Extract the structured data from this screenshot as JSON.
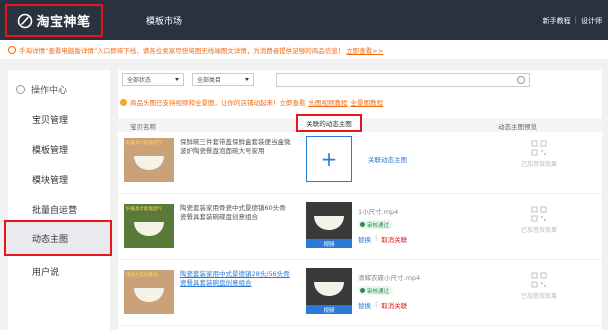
{
  "header": {
    "logo_text": "淘宝神笔",
    "nav_title": "模板市场",
    "links": [
      "新手教程",
      "设计师"
    ],
    "link_separator": "|"
  },
  "notice": {
    "text": "手淘详情“查看电脑版详情”入口即将下线，请各位卖家尽快将图无线端图文详情，为消费者提供足够的商品信息！",
    "link": "立即查看>>"
  },
  "sidebar": {
    "heading": "操作中心",
    "items": [
      {
        "label": "宝贝管理"
      },
      {
        "label": "模板管理"
      },
      {
        "label": "模块管理"
      },
      {
        "label": "批量自运营"
      },
      {
        "label": "动态主图",
        "active": true
      },
      {
        "label": "用户说"
      }
    ]
  },
  "filters": {
    "status": "全部状态",
    "category": "全部类目",
    "search_placeholder": ""
  },
  "tip": {
    "text": "商品头图已支持视频和全景图，让你的店铺动起来！立即查看",
    "links": [
      "头图视频教程",
      "全景图教程"
    ]
  },
  "table": {
    "columns": [
      "宝贝名称",
      "关联的动态主图",
      "动态主图预览"
    ],
    "rows": [
      {
        "thumb_caption": "好餐具才能做酒气",
        "title": "保鲜碗三件套带盖保鲜盒套装便当盒微波炉陶瓷餐盘泡面碗大号家用",
        "title_link": false,
        "video": null,
        "add_label": "+",
        "assoc_label": "关联动态主图",
        "preview_text": "已加音效效果"
      },
      {
        "thumb_caption": "好餐具才能做酒气",
        "title": "陶瓷套装家用骨瓷中式景德镇60头骨瓷餐具套装碗碟盘创意组合",
        "title_link": false,
        "video": {
          "name": "1小尺寸.mp4",
          "status": "审核通过",
          "label": "视频",
          "replace": "替换",
          "cancel": "取消关联"
        },
        "preview_text": "已加音效效果"
      },
      {
        "thumb_caption": "送受才是好餐具",
        "title": "陶瓷套装家用中式景德镇28头/56头骨瓷餐具套装碗盘创意组合",
        "title_link": true,
        "video": {
          "name": "清辉衣碟小尺寸.mp4",
          "status": "审核通过",
          "label": "视频",
          "replace": "替换",
          "cancel": "取消关联"
        },
        "preview_text": "已加音效效果"
      }
    ]
  },
  "colors": {
    "highlight": "#e8151b",
    "accent": "#2b7bd6",
    "warning": "#f26a10",
    "topbar": "#2a3240"
  }
}
